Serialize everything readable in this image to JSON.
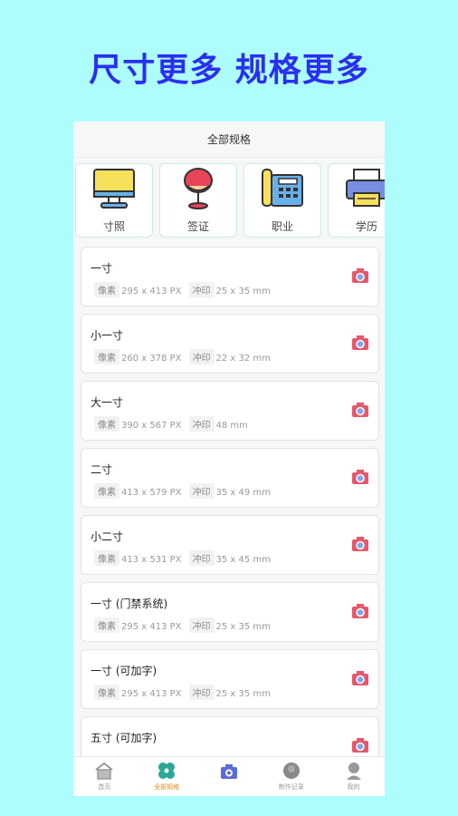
{
  "headline": "尺寸更多 规格更多",
  "topbar": {
    "title": "全部规格"
  },
  "categories": [
    {
      "label": "寸照",
      "icon": "monitor-icon"
    },
    {
      "label": "签证",
      "icon": "balloon-chair-icon"
    },
    {
      "label": "职业",
      "icon": "telephone-icon"
    },
    {
      "label": "学历",
      "icon": "printer-icon"
    }
  ],
  "specs": [
    {
      "name": "一寸",
      "pixel_label": "像素",
      "pixels": "295 x 413 PX",
      "print_label": "冲印",
      "print": "25 x 35 mm"
    },
    {
      "name": "小一寸",
      "pixel_label": "像素",
      "pixels": "260 x 378 PX",
      "print_label": "冲印",
      "print": "22 x 32 mm"
    },
    {
      "name": "大一寸",
      "pixel_label": "像素",
      "pixels": "390 x 567 PX",
      "print_label": "冲印",
      "print": "48 mm"
    },
    {
      "name": "二寸",
      "pixel_label": "像素",
      "pixels": "413 x 579 PX",
      "print_label": "冲印",
      "print": "35 x 49 mm"
    },
    {
      "name": "小二寸",
      "pixel_label": "像素",
      "pixels": "413 x 531 PX",
      "print_label": "冲印",
      "print": "35 x 45 mm"
    },
    {
      "name": "一寸 (门禁系统)",
      "pixel_label": "像素",
      "pixels": "295 x 413 PX",
      "print_label": "冲印",
      "print": "25 x 35 mm"
    },
    {
      "name": "一寸 (可加字)",
      "pixel_label": "像素",
      "pixels": "295 x 413 PX",
      "print_label": "冲印",
      "print": "25 x 35 mm"
    },
    {
      "name": "五寸 (可加字)",
      "pixel_label": "",
      "pixels": "",
      "print_label": "",
      "print": ""
    }
  ],
  "tabbar": {
    "items": [
      {
        "label": "首页",
        "icon": "home-icon"
      },
      {
        "label": "全部规格",
        "icon": "clover-icon",
        "active": true
      },
      {
        "label": "",
        "icon": "camera-icon"
      },
      {
        "label": "制作记录",
        "icon": "record-icon"
      },
      {
        "label": "我的",
        "icon": "user-icon"
      }
    ]
  },
  "colors": {
    "background": "#adfdfd",
    "headline": "#2a2ff0",
    "active_tab": "#e08a20",
    "camera_icon": "#e8566c"
  }
}
